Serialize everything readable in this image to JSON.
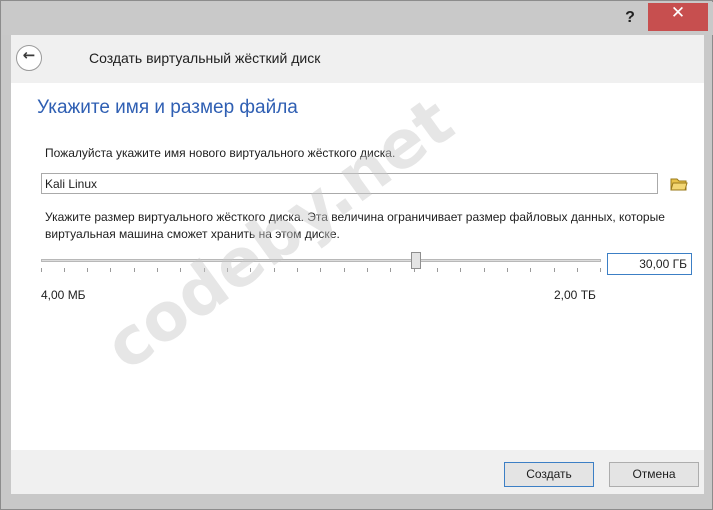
{
  "window": {
    "help": "?",
    "close": "✕"
  },
  "header": {
    "title": "Создать виртуальный жёсткий диск"
  },
  "content": {
    "heading": "Укажите имя и размер файла",
    "name_prompt": "Пожалуйста укажите имя нового виртуального жёсткого диска.",
    "name_value": "Kali Linux",
    "size_prompt": "Укажите размер виртуального жёсткого диска. Эта величина ограничивает размер файловых данных, которые виртуальная машина сможет хранить на этом диске.",
    "size_min": "4,00 МБ",
    "size_max": "2,00 ТБ",
    "size_value": "30,00 ГБ"
  },
  "watermark": "codeby.net",
  "footer": {
    "create": "Создать",
    "cancel": "Отмена"
  },
  "icons": {
    "back": "back-arrow-icon",
    "folder": "folder-icon"
  }
}
